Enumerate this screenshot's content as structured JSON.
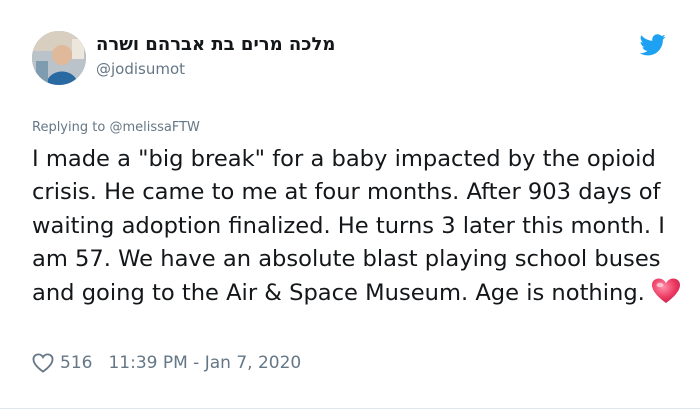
{
  "author": {
    "display_name": "מלכה מרים בת אברהם ושרה",
    "handle": "@jodisumot"
  },
  "reply_context": {
    "prefix": "Replying to",
    "mention": "@melissaFTW"
  },
  "tweet": {
    "text": "I made a \"big break\" for a baby impacted by the opioid crisis. He came to me at four months. After 903 days of waiting adoption finalized. He turns 3 later this month. I am 57. We have an absolute blast playing school buses and going to the Air & Space Museum. Age is nothing."
  },
  "footer": {
    "like_count": "516",
    "timestamp": "11:39 PM - Jan 7, 2020"
  },
  "icons": {
    "brand": "twitter-bird-icon",
    "like": "heart-outline-icon",
    "emoji": "heart-emoji-icon"
  },
  "colors": {
    "twitter_blue": "#1da1f2",
    "secondary_text": "#657786",
    "primary_text": "#14171a",
    "emoji_red": "#e0245e"
  }
}
